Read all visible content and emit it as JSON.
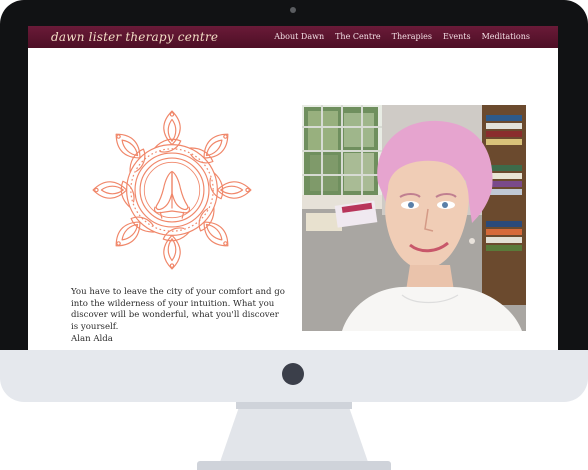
{
  "site": {
    "brand": "dawn lister therapy centre",
    "nav": [
      "About Dawn",
      "The Centre",
      "Therapies",
      "Events",
      "Meditations"
    ]
  },
  "quote": {
    "text": "You have to leave the city of your comfort and go into the wilderness of your intuition. What you discover will be wonderful, what you'll discover is yourself.",
    "author": "Alan Alda"
  },
  "colors": {
    "nav_bg": "#5a1530",
    "brand_text": "#f1dcc4",
    "mandala": "#f0876a",
    "bezel": "#111214"
  },
  "icons": {
    "mandala": "praying-hands-mandala-icon"
  }
}
